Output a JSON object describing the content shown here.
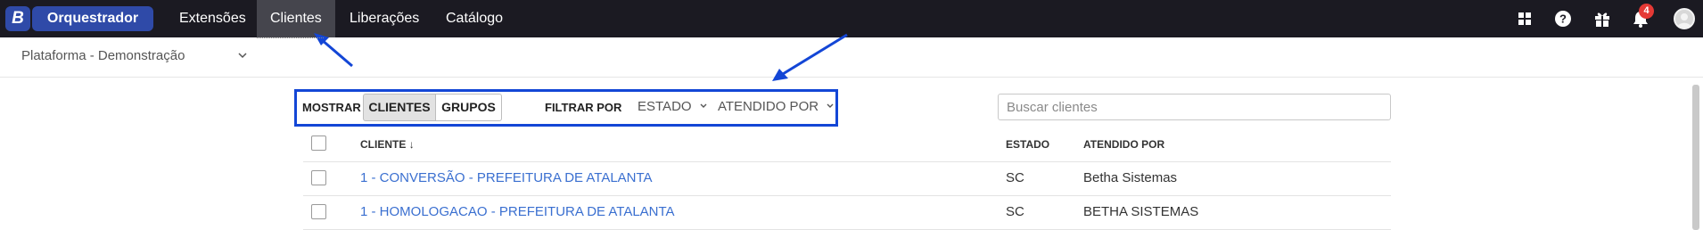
{
  "nav": {
    "logo": "B",
    "app_name": "Orquestrador",
    "items": [
      {
        "label": "Extensões"
      },
      {
        "label": "Clientes"
      },
      {
        "label": "Liberações"
      },
      {
        "label": "Catálogo"
      }
    ],
    "notification_count": "4",
    "icons": [
      "apps-grid-icon",
      "help-icon",
      "gift-icon",
      "bell-icon",
      "user-avatar"
    ]
  },
  "context": {
    "label": "Plataforma - Demonstração"
  },
  "toolbar": {
    "mostrar_label": "MOSTRAR",
    "toggle": [
      "CLIENTES",
      "GRUPOS"
    ],
    "selected_toggle": "CLIENTES",
    "filtrar_label": "FILTRAR POR",
    "filters": [
      "ESTADO",
      "ATENDIDO POR"
    ]
  },
  "search": {
    "placeholder": "Buscar clientes"
  },
  "table": {
    "headers": [
      "CLIENTE",
      "ESTADO",
      "ATENDIDO POR"
    ],
    "sort_indicator": "↓",
    "rows": [
      {
        "cliente": "1 - CONVERSÃO - PREFEITURA DE ATALANTA",
        "estado": "SC",
        "atendido": "Betha Sistemas"
      },
      {
        "cliente": "1 - HOMOLOGACAO - PREFEITURA DE ATALANTA",
        "estado": "SC",
        "atendido": "BETHA SISTEMAS"
      }
    ]
  },
  "colors": {
    "topbar": "#1b1a22",
    "brand": "#2f4aa8",
    "annotation": "#1346d6",
    "link": "#3a6fd0",
    "badge": "#e53935"
  }
}
